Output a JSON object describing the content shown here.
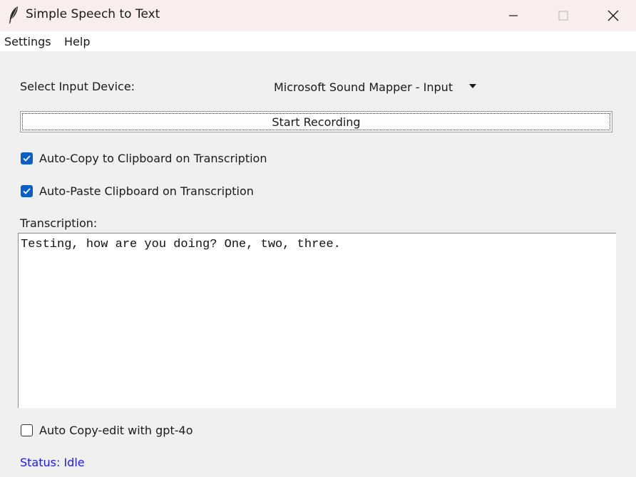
{
  "window": {
    "title": "Simple Speech to Text",
    "controls": [
      "minimize",
      "maximize",
      "close"
    ]
  },
  "menubar": {
    "items": [
      {
        "label": "Settings"
      },
      {
        "label": "Help"
      }
    ]
  },
  "input_device": {
    "label": "Select Input Device:",
    "selected": "Microsoft Sound Mapper - Input"
  },
  "record_button": {
    "label": "Start Recording"
  },
  "options": {
    "auto_copy": {
      "label": "Auto-Copy to Clipboard on Transcription",
      "checked": true
    },
    "auto_paste": {
      "label": "Auto-Paste Clipboard on Transcription",
      "checked": true
    },
    "auto_copyedit": {
      "label": "Auto Copy-edit with gpt-4o",
      "checked": false
    }
  },
  "transcription": {
    "label": "Transcription:",
    "text": "Testing, how are you doing? One, two, three."
  },
  "status": {
    "text": "Status: Idle",
    "color": "#1a1aff"
  },
  "colors": {
    "checkbox_accent": "#0a5fc4",
    "titlebar_bg": "#f9eded"
  },
  "icons": {
    "app": "feather-icon",
    "dropdown": "triangle-down-icon"
  }
}
